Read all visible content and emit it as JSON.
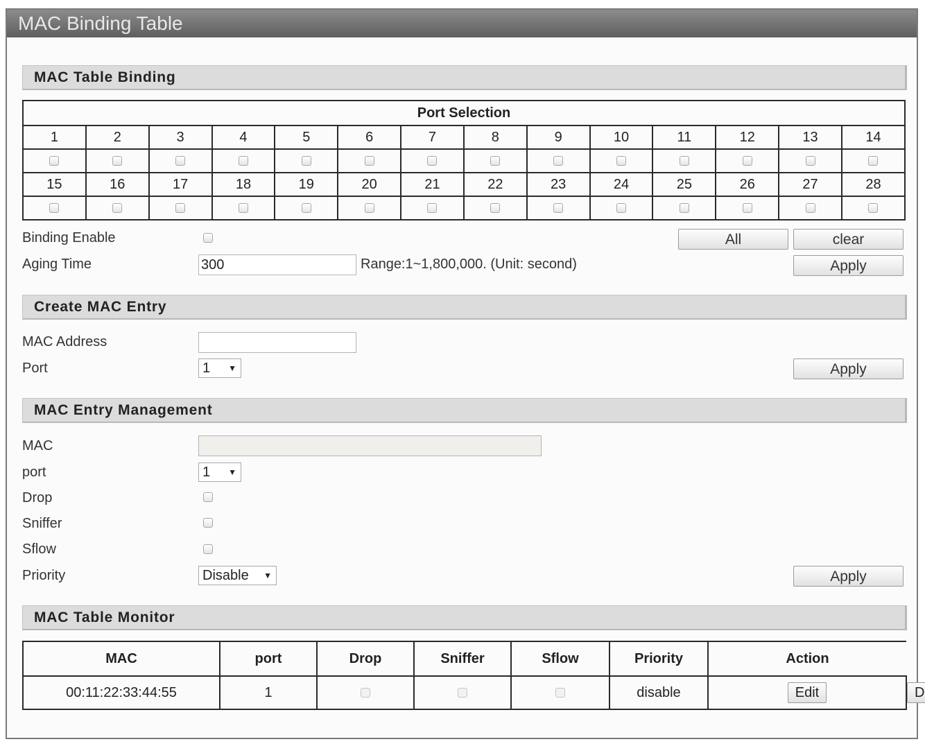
{
  "window": {
    "title": "MAC Binding Table"
  },
  "sections": {
    "binding": "MAC Table Binding",
    "create": "Create MAC Entry",
    "management": "MAC Entry Management",
    "monitor": "MAC Table Monitor"
  },
  "port_selection": {
    "header": "Port Selection",
    "row1": [
      "1",
      "2",
      "3",
      "4",
      "5",
      "6",
      "7",
      "8",
      "9",
      "10",
      "11",
      "12",
      "13",
      "14"
    ],
    "row2": [
      "15",
      "16",
      "17",
      "18",
      "19",
      "20",
      "21",
      "22",
      "23",
      "24",
      "25",
      "26",
      "27",
      "28"
    ]
  },
  "binding": {
    "enable_label": "Binding Enable",
    "aging_label": "Aging Time",
    "aging_value": "300",
    "range_text": "Range:1~1,800,000. (Unit: second)",
    "all_label": "All",
    "clear_label": "clear",
    "apply_label": "Apply"
  },
  "create": {
    "mac_label": "MAC Address",
    "mac_value": "",
    "port_label": "Port",
    "port_value": "1",
    "apply_label": "Apply"
  },
  "management": {
    "mac_label": "MAC",
    "mac_value": "",
    "port_label": "port",
    "port_value": "1",
    "drop_label": "Drop",
    "sniffer_label": "Sniffer",
    "sflow_label": "Sflow",
    "priority_label": "Priority",
    "priority_value": "Disable",
    "apply_label": "Apply"
  },
  "monitor": {
    "columns": [
      "MAC",
      "port",
      "Drop",
      "Sniffer",
      "Sflow",
      "Priority",
      "Action"
    ],
    "rows": [
      {
        "mac": "00:11:22:33:44:55",
        "port": "1",
        "priority": "disable",
        "edit_label": "Edit",
        "delete_label": "Delete"
      }
    ]
  }
}
